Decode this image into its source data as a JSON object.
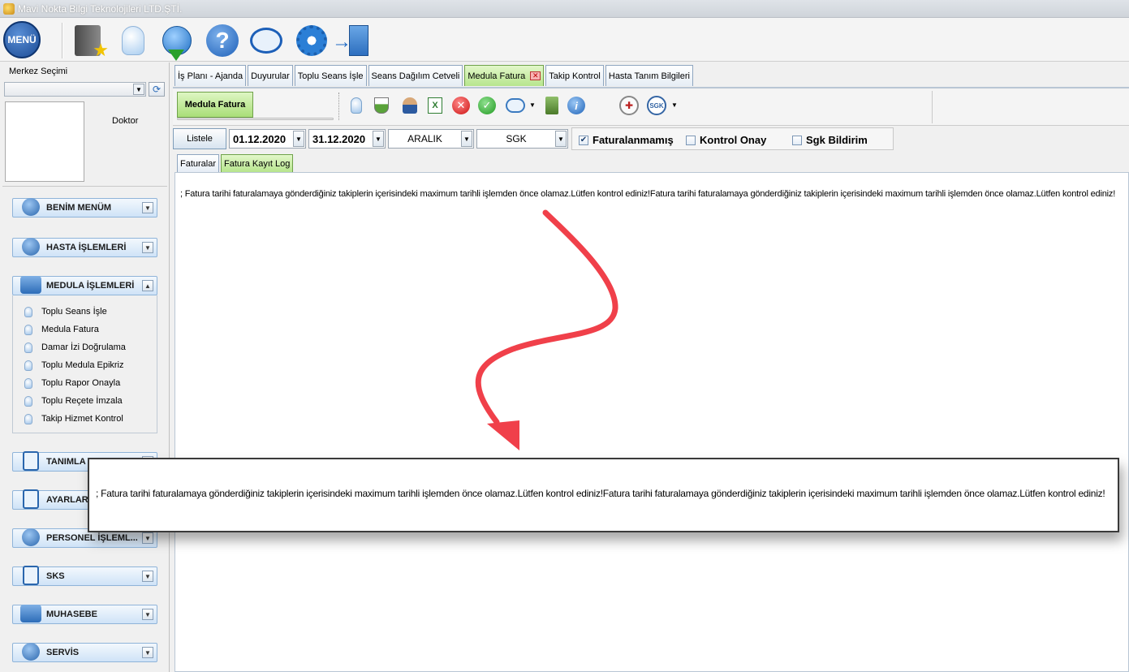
{
  "window": {
    "title": "Mavi Nokta Bilgi Teknolojileri LTD.ŞTİ."
  },
  "main_toolbar": {
    "menu_label": "MENÜ",
    "icons": [
      "book-star-icon",
      "lightbulb-icon",
      "globe-download-icon",
      "help-icon",
      "chat-icon",
      "gear-icon",
      "exit-icon"
    ]
  },
  "left": {
    "center_label": "Merkez Seçimi",
    "doctor_label": "Doktor",
    "groups": [
      {
        "label": "BENİM MENÜM"
      },
      {
        "label": "HASTA İŞLEMLERİ"
      },
      {
        "label": "MEDULA İŞLEMLERİ"
      },
      {
        "label": "TANIMLA"
      },
      {
        "label": "AYARLAR"
      },
      {
        "label": "PERSONEL İŞLEML..."
      },
      {
        "label": "SKS"
      },
      {
        "label": "MUHASEBE"
      },
      {
        "label": "SERVİS"
      }
    ],
    "medula_items": [
      "Toplu Seans İşle",
      "Medula Fatura",
      "Damar İzi Doğrulama",
      "Toplu Medula Epikriz",
      "Toplu Rapor Onayla",
      "Toplu Reçete İmzala",
      "Takip Hizmet Kontrol"
    ]
  },
  "tabs": [
    {
      "label": "İş Planı - Ajanda"
    },
    {
      "label": "Duyurular"
    },
    {
      "label": "Toplu Seans İşle"
    },
    {
      "label": "Seans Dağılım Cetveli"
    },
    {
      "label": "Medula Fatura",
      "active": true
    },
    {
      "label": "Takip Kontrol"
    },
    {
      "label": "Hasta Tanım Bilgileri"
    }
  ],
  "subtoolbar": {
    "tab_label": "Medula Fatura",
    "icons": [
      "lightbulb-icon",
      "flask-info-icon",
      "user-icon",
      "excel-icon",
      "cancel-icon",
      "check-icon",
      "speech-icon",
      "trash-icon",
      "info-icon",
      "ministry-seal-icon",
      "sgk-logo-icon"
    ]
  },
  "filters": {
    "listele_label": "Listele",
    "start_date": "01.12.2020",
    "end_date": "31.12.2020",
    "month": "ARALIK",
    "institution": "SGK",
    "checks": [
      {
        "label": "Faturalanmamış",
        "checked": true
      },
      {
        "label": "Kontrol Onay",
        "checked": false
      },
      {
        "label": "Sgk Bildirim",
        "checked": false
      }
    ]
  },
  "inner_tabs": [
    {
      "label": "Faturalar"
    },
    {
      "label": "Fatura Kayıt Log",
      "active": true
    }
  ],
  "log": {
    "text": "; Fatura tarihi faturalamaya gönderdiğiniz takiplerin içerisindeki maximum tarihli işlemden önce olamaz.Lütfen kontrol ediniz!Fatura tarihi faturalamaya gönderdiğiniz takiplerin içerisindeki maximum tarihli işlemden önce olamaz.Lütfen kontrol ediniz!"
  },
  "popup": {
    "text": "; Fatura tarihi faturalamaya gönderdiğiniz takiplerin içerisindeki maximum tarihli işlemden önce olamaz.Lütfen kontrol ediniz!Fatura tarihi faturalamaya gönderdiğiniz takiplerin içerisindeki maximum tarihli işlemden önce olamaz.Lütfen kontrol ediniz!"
  },
  "colors": {
    "annotation_arrow": "#f0404a",
    "active_tab": "#b7e58d",
    "nav_group": "#cfe3f7"
  }
}
